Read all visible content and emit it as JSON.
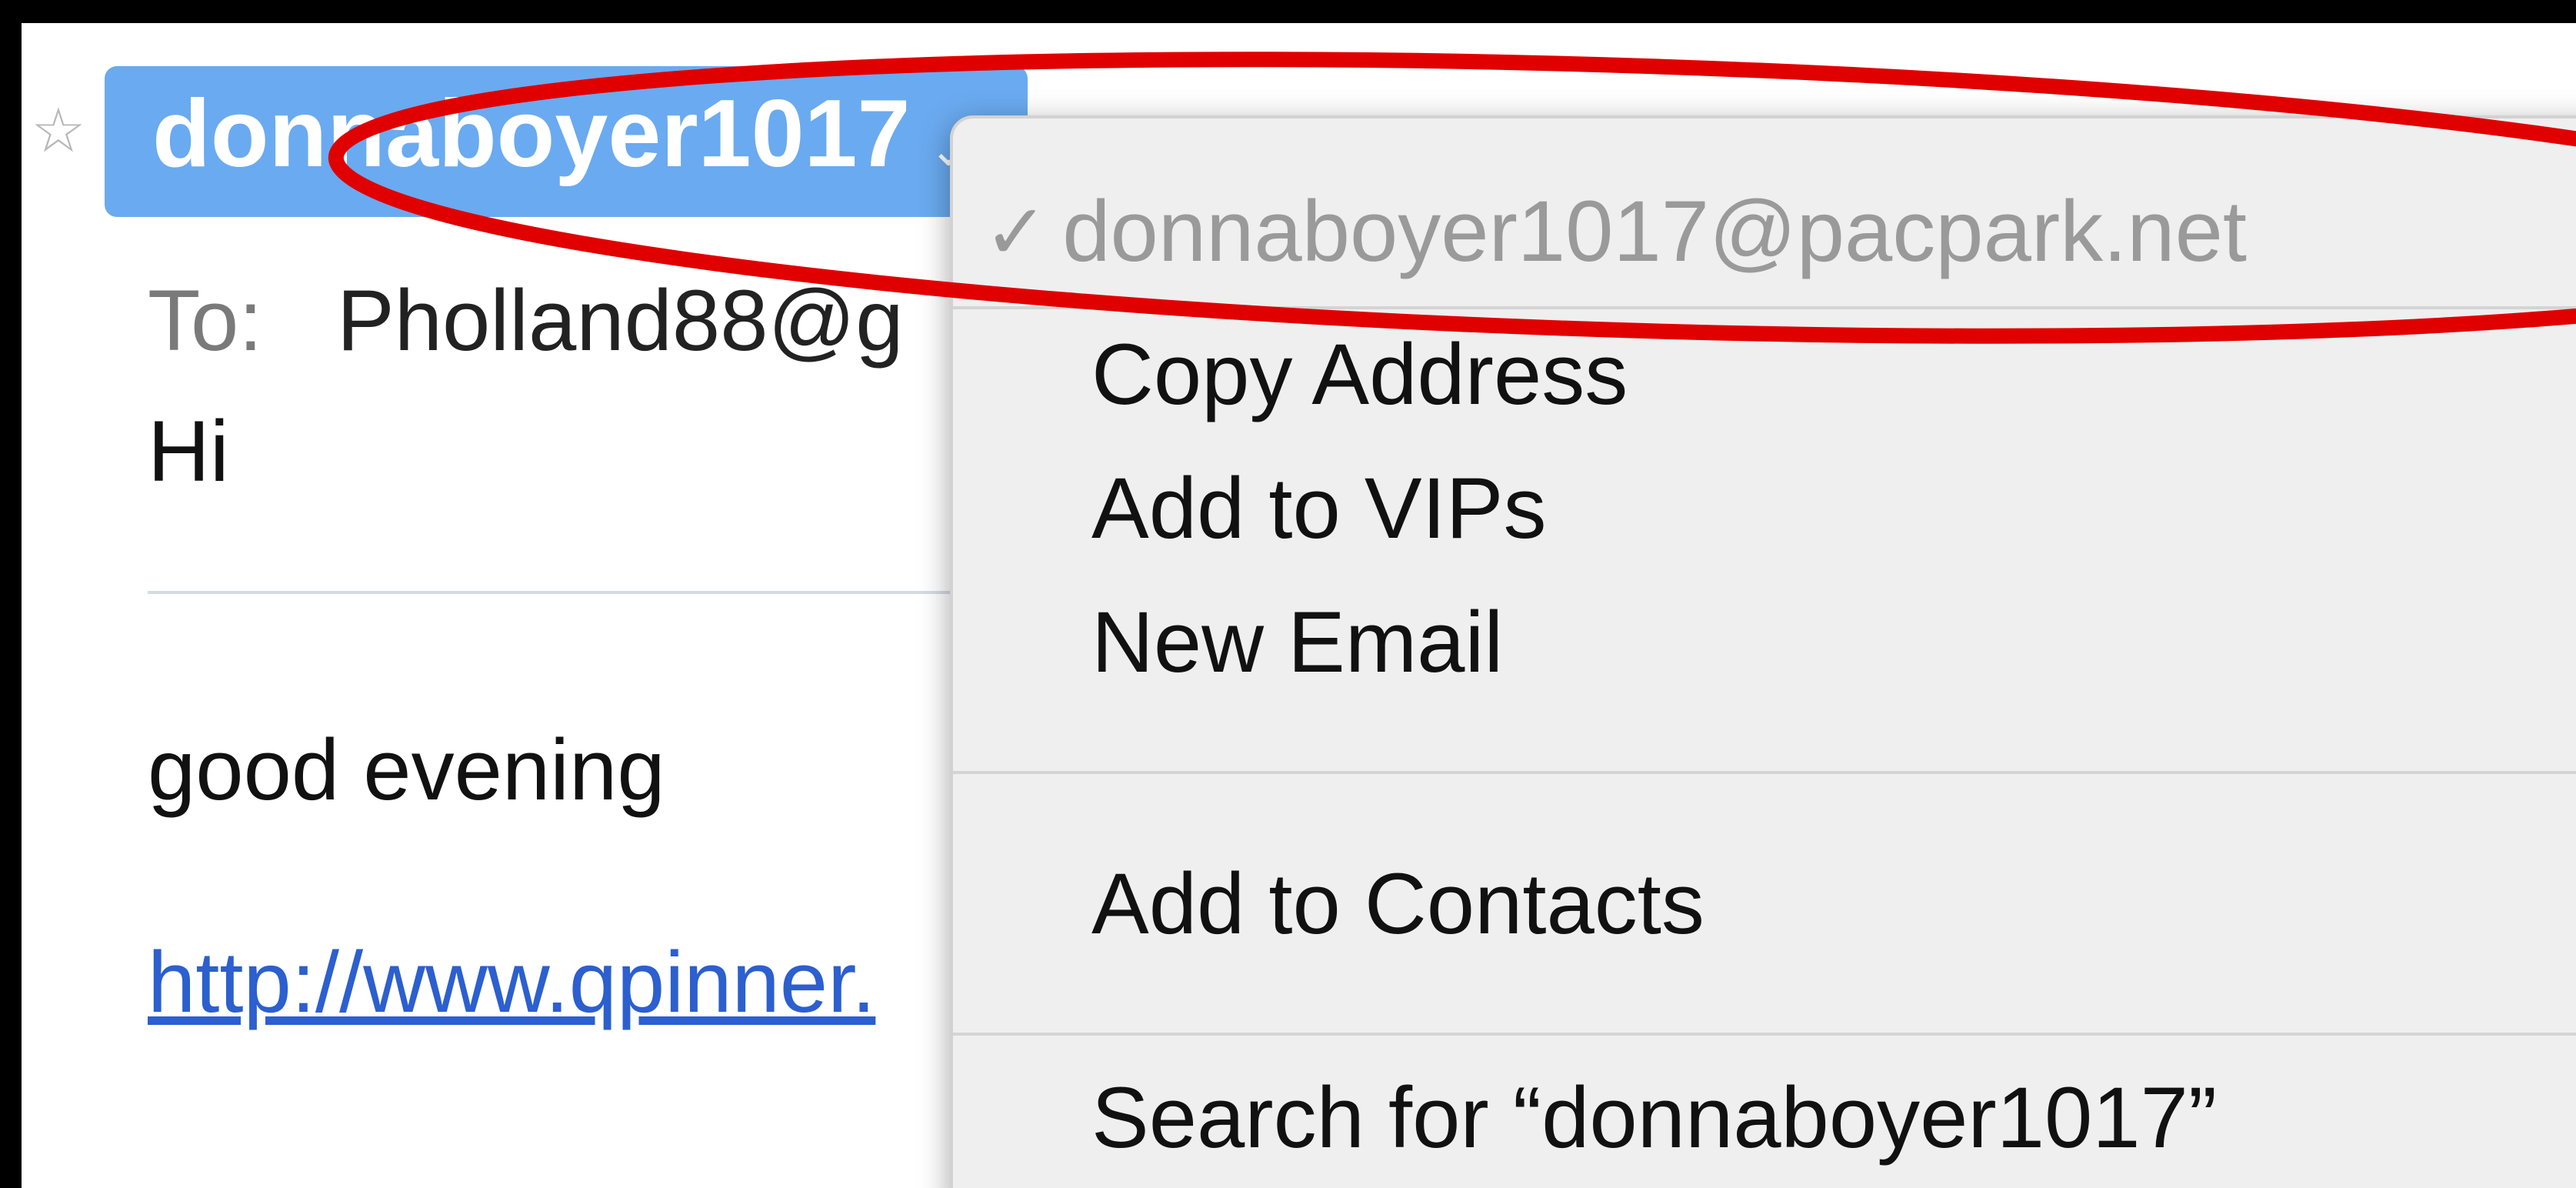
{
  "message": {
    "star_icon": "☆",
    "sender": "donnaboyer1017",
    "sender_chevron": "⌄",
    "to_label": "To:",
    "to_value": "Pholland88@g",
    "subject": "Hi",
    "body_text": "good evening",
    "body_link": "http://www.qpinner."
  },
  "context_menu": {
    "check_icon": "✓",
    "address": "donnaboyer1017@pacpark.net",
    "items": [
      "Copy Address",
      "Add to VIPs",
      "New Email",
      "Add to Contacts",
      "Search for “donnaboyer1017”"
    ]
  },
  "colors": {
    "chip": "#6aaaf0",
    "link": "#2c5fcf",
    "annotation": "#e00000"
  }
}
